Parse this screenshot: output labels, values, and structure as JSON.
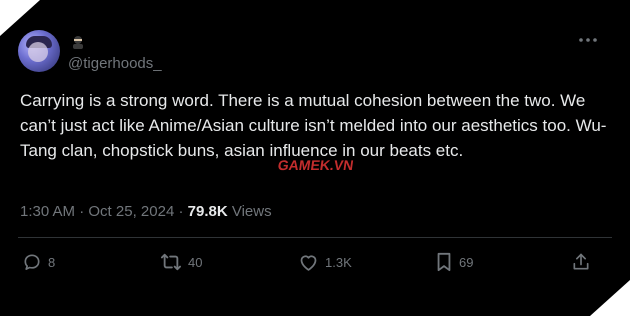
{
  "tweet": {
    "handle": "@tigerhoods_",
    "text": "Carrying is a strong word. There is a mutual cohesion between the two. We can’t just act like Anime/Asian culture isn’t melded into our aesthetics too. Wu-Tang clan, chopstick buns, asian influence in our beats etc.",
    "time": "1:30 AM",
    "date": "Oct 25, 2024",
    "views_count": "79.8K",
    "views_label": "Views"
  },
  "actions": {
    "replies": "8",
    "reposts": "40",
    "likes": "1.3K",
    "bookmarks": "69"
  },
  "watermark": "GAMEK.VN",
  "icons": {
    "more": "more-horizontal-icon",
    "reply": "reply-icon",
    "repost": "repost-icon",
    "like": "heart-icon",
    "bookmark": "bookmark-icon",
    "share": "share-icon"
  },
  "colors": {
    "background": "#000000",
    "text": "#e7e9ea",
    "secondary": "#71767b",
    "divider": "#2f3336"
  }
}
